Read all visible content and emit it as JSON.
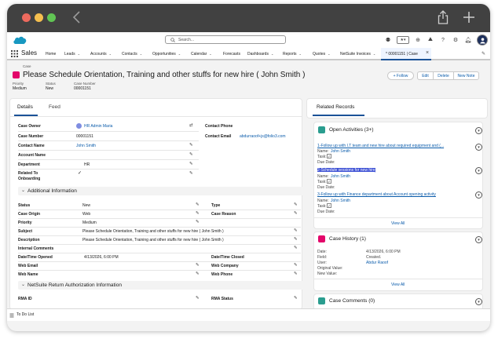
{
  "app": {
    "name": "Sales"
  },
  "search": {
    "placeholder": "Search..."
  },
  "nav": {
    "items": [
      "Home",
      "Leads",
      "Accounts",
      "Contacts",
      "Opportunities",
      "Calendar",
      "Forecasts",
      "Dashboards",
      "Reports",
      "Quotes",
      "NetSuite Invoices"
    ],
    "active_tab": "* 00001151 | Case"
  },
  "header": {
    "object_label": "Case",
    "title": "Please Schedule Orientation, Training and other stuffs for new hire ( John Smith )",
    "priority_label": "Priority",
    "priority": "Medium",
    "status_label": "Status",
    "status": "New",
    "case_number_label": "Case Number",
    "case_number": "00001151",
    "buttons": {
      "follow": "+ Follow",
      "edit": "Edit",
      "delete": "Delete",
      "new_note": "New Note"
    }
  },
  "left": {
    "tabs": {
      "details": "Details",
      "feed": "Feed"
    },
    "fields": {
      "case_owner_label": "Case Owner",
      "case_owner": "HR Admin Maria",
      "contact_phone_label": "Contact Phone",
      "case_number_label": "Case Number",
      "case_number": "00001151",
      "contact_email_label": "Contact Email",
      "contact_email": "abdurraoof+js@folio3.com",
      "contact_name_label": "Contact Name",
      "contact_name": "John Smith",
      "account_name_label": "Account Name",
      "department_label": "Department",
      "department": "HR",
      "related_onboarding_label": "Related To Onboarding"
    },
    "additional": {
      "title": "Additional Information",
      "status_label": "Status",
      "status": "New",
      "type_label": "Type",
      "case_origin_label": "Case Origin",
      "case_origin": "Web",
      "case_reason_label": "Case Reason",
      "priority_label": "Priority",
      "priority": "Medium",
      "subject_label": "Subject",
      "subject": "Please Schedule Orientation, Training and other stuffs for new hire ( John Smith )",
      "description_label": "Description",
      "description": "Please Schedule Orientation, Training and other stuffs for new hire ( John Smith )",
      "internal_comments_label": "Internal Comments",
      "opened_label": "Date/Time Opened",
      "opened": "4/13/2026, 6:00 PM",
      "closed_label": "Date/Time Closed",
      "web_email_label": "Web Email",
      "web_company_label": "Web Company",
      "web_name_label": "Web Name",
      "web_phone_label": "Web Phone"
    },
    "netsuite": {
      "title": "NetSuite Return Authorization Information",
      "rma_id_label": "RMA ID",
      "rma_status_label": "RMA Status"
    }
  },
  "related": {
    "tab": "Related Records",
    "open_activities": {
      "title": "Open Activities (3+)",
      "items": [
        {
          "subject": "1-Follow up with I.T team and new hire about required equipment and (...",
          "name_label": "Name:",
          "name": "John Smith",
          "task_label": "Task:",
          "due_label": "Due Date:"
        },
        {
          "subject": "2-Schedule sessions for new hire",
          "name_label": "Name:",
          "name": "John Smith",
          "task_label": "Task:",
          "due_label": "Due Date:"
        },
        {
          "subject": "3-Follow up with Finance department about Account opening activity",
          "name_label": "Name:",
          "name": "John Smith",
          "task_label": "Task:",
          "due_label": "Due Date:"
        }
      ],
      "view_all": "View All"
    },
    "case_history": {
      "title": "Case History (1)",
      "date_label": "Date:",
      "date": "4/13/2026, 6:00 PM",
      "field_label": "Field:",
      "field": "Created.",
      "user_label": "User:",
      "user": "Abdur Raoof",
      "original_label": "Original Value:",
      "new_label": "New Value:",
      "view_all": "View All"
    },
    "case_comments": {
      "title": "Case Comments (0)"
    }
  },
  "footer": {
    "todo": "To Do List"
  },
  "colors": {
    "brand": "#1b5297",
    "link": "#0b5cab",
    "case_icon": "#e3066a",
    "activity_icon": "#2a9d8f",
    "history_icon": "#e3066a"
  }
}
